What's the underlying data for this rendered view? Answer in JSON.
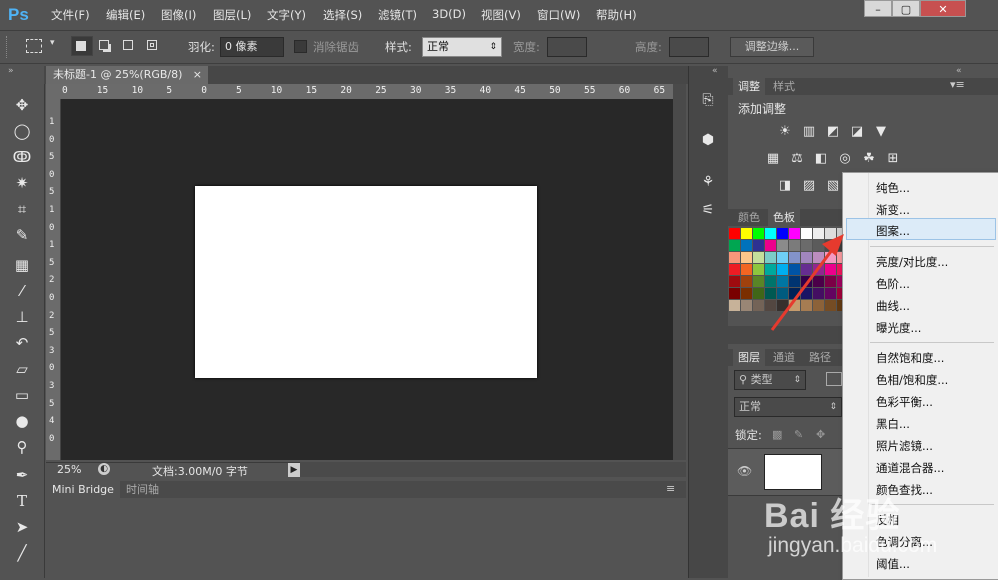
{
  "app": {
    "logo": "Ps"
  },
  "menubar": {
    "items": [
      "文件(F)",
      "编辑(E)",
      "图像(I)",
      "图层(L)",
      "文字(Y)",
      "选择(S)",
      "滤镜(T)",
      "3D(D)",
      "视图(V)",
      "窗口(W)",
      "帮助(H)"
    ],
    "window_controls": [
      "–",
      "▢",
      "✕"
    ]
  },
  "options": {
    "feather_label": "羽化:",
    "feather_value": "0 像素",
    "antialias_label": "消除锯齿",
    "style_label": "样式:",
    "style_value": "正常",
    "width_label": "宽度:",
    "height_label": "高度:",
    "refine_button": "调整边缘..."
  },
  "document": {
    "tab_title": "未标题-1 @ 25%(RGB/8)",
    "close": "×",
    "ruler_top_ticks": [
      "0",
      "15",
      "10",
      "5",
      "0",
      "5",
      "10",
      "15",
      "20",
      "25",
      "30",
      "35",
      "40",
      "45",
      "50",
      "55",
      "60",
      "65"
    ],
    "ruler_left_ticks": [
      "1",
      "0",
      "5",
      "0",
      "5",
      "1",
      "0",
      "1",
      "5",
      "2",
      "0",
      "2",
      "5",
      "3",
      "0",
      "3",
      "5",
      "4",
      "0"
    ],
    "zoom": "25%",
    "doc_info": "文档:3.00M/0 字节"
  },
  "bottom_panel": {
    "tabs": [
      "Mini Bridge",
      "时间轴"
    ]
  },
  "adjustments": {
    "tabs": [
      "调整",
      "样式"
    ],
    "title": "添加调整",
    "icons_row1": [
      "brightness-icon",
      "levels-icon",
      "curves-icon",
      "exposure-icon",
      "triangle-icon"
    ],
    "icons_row2": [
      "hue-icon",
      "balance-icon",
      "bw-icon",
      "photo-filter-icon",
      "channel-mixer-icon",
      "lookup-icon"
    ],
    "icons_row3": [
      "invert-icon",
      "posterize-icon",
      "gradient-map-icon"
    ]
  },
  "swatches_panel": {
    "tabs": [
      "颜色",
      "色板"
    ]
  },
  "layers_panel": {
    "tabs": [
      "图层",
      "通道",
      "路径"
    ],
    "kind_filter": "类型",
    "blend_mode": "正常",
    "lock_label": "锁定:"
  },
  "context_menu": {
    "items": [
      "纯色...",
      "渐变...",
      "图案...",
      "亮度/对比度...",
      "色阶...",
      "曲线...",
      "曝光度...",
      "自然饱和度...",
      "色相/饱和度...",
      "色彩平衡...",
      "黑白...",
      "照片滤镜...",
      "通道混合器...",
      "颜色查找...",
      "反相",
      "色调分离...",
      "阈值..."
    ],
    "highlighted": "图案..."
  },
  "watermark": {
    "brand": "Bai 经验",
    "url": "jingyan.baidu.com"
  },
  "colors": {
    "canvas_bg": "#282828",
    "ui_bg": "#535353",
    "highlight": "#dcebf8",
    "arrow": "#e63a2e"
  }
}
